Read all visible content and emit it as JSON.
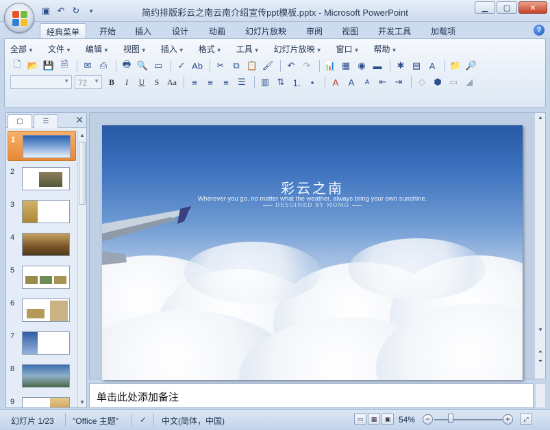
{
  "window": {
    "title": "简约排版彩云之南云南介绍宣传ppt模板.pptx - Microsoft PowerPoint",
    "buttons": [
      "minimize",
      "maximize",
      "close"
    ]
  },
  "quick_access": [
    "save-icon",
    "undo-icon",
    "redo-icon",
    "customize-icon"
  ],
  "ribbon_tabs": [
    {
      "label": "经典菜单",
      "active": true
    },
    {
      "label": "开始"
    },
    {
      "label": "插入"
    },
    {
      "label": "设计"
    },
    {
      "label": "动画"
    },
    {
      "label": "幻灯片放映"
    },
    {
      "label": "审阅"
    },
    {
      "label": "视图"
    },
    {
      "label": "开发工具"
    },
    {
      "label": "加载项"
    }
  ],
  "classic_menus": [
    "全部",
    "文件",
    "编辑",
    "视图",
    "插入",
    "格式",
    "工具",
    "幻灯片放映",
    "窗口",
    "帮助"
  ],
  "font_size_value": "72",
  "slides_panel": {
    "thumbnails": [
      {
        "num": "1",
        "selected": true
      },
      {
        "num": "2"
      },
      {
        "num": "3"
      },
      {
        "num": "4"
      },
      {
        "num": "5"
      },
      {
        "num": "6"
      },
      {
        "num": "7"
      },
      {
        "num": "8"
      },
      {
        "num": "9"
      }
    ]
  },
  "slide": {
    "title": "彩云之南",
    "subtitle": "Wherever you go, no matter what the weather, always bring your own sunshine.",
    "credit": "DESGINED BY MOMO"
  },
  "notes": {
    "placeholder": "单击此处添加备注"
  },
  "status": {
    "slide_counter": "幻灯片 1/23",
    "theme": "\"Office 主题\"",
    "language": "中文(简体，中国)",
    "zoom": "54%"
  },
  "colors": {
    "accent_selected": "#e88a36",
    "ribbon_bg": "#dde7f4"
  }
}
